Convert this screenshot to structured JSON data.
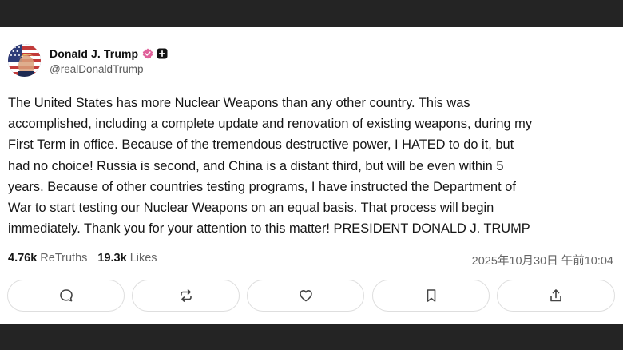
{
  "post": {
    "author": {
      "display_name": "Donald J. Trump",
      "handle": "@realDonaldTrump",
      "avatar_icon": "avatar-flag-portrait",
      "verified_icon": "verified-badge-icon",
      "badge_icon": "plus-badge-icon"
    },
    "body_lines": [
      "The United States has more Nuclear Weapons than any other country. This was",
      "accomplished, including a complete update and renovation of existing weapons, during my",
      "First Term in office. Because of the tremendous destructive power, I HATED to do it, but",
      "had no choice! Russia is second, and China is a distant third, but will be even within 5",
      "years. Because of other countries testing programs, I have instructed the Department of",
      "War to start testing our Nuclear Weapons on an equal basis. That process will begin",
      "immediately. Thank you for your attention to this matter! PRESIDENT DONALD J. TRUMP"
    ],
    "stats": {
      "retruths_count": "4.76k",
      "retruths_label": "ReTruths",
      "likes_count": "19.3k",
      "likes_label": "Likes"
    },
    "timestamp": "2025年10月30日 午前10:04",
    "actions": [
      {
        "name": "reply",
        "icon": "reply-icon"
      },
      {
        "name": "retruth",
        "icon": "retruth-icon"
      },
      {
        "name": "like",
        "icon": "heart-icon"
      },
      {
        "name": "bookmark",
        "icon": "bookmark-icon"
      },
      {
        "name": "share",
        "icon": "share-icon"
      }
    ]
  },
  "colors": {
    "background_bar": "#242424",
    "card": "#ffffff",
    "verified_badge": "#e0609a",
    "text": "#161616",
    "muted": "#666666",
    "button_border": "#dedede"
  }
}
